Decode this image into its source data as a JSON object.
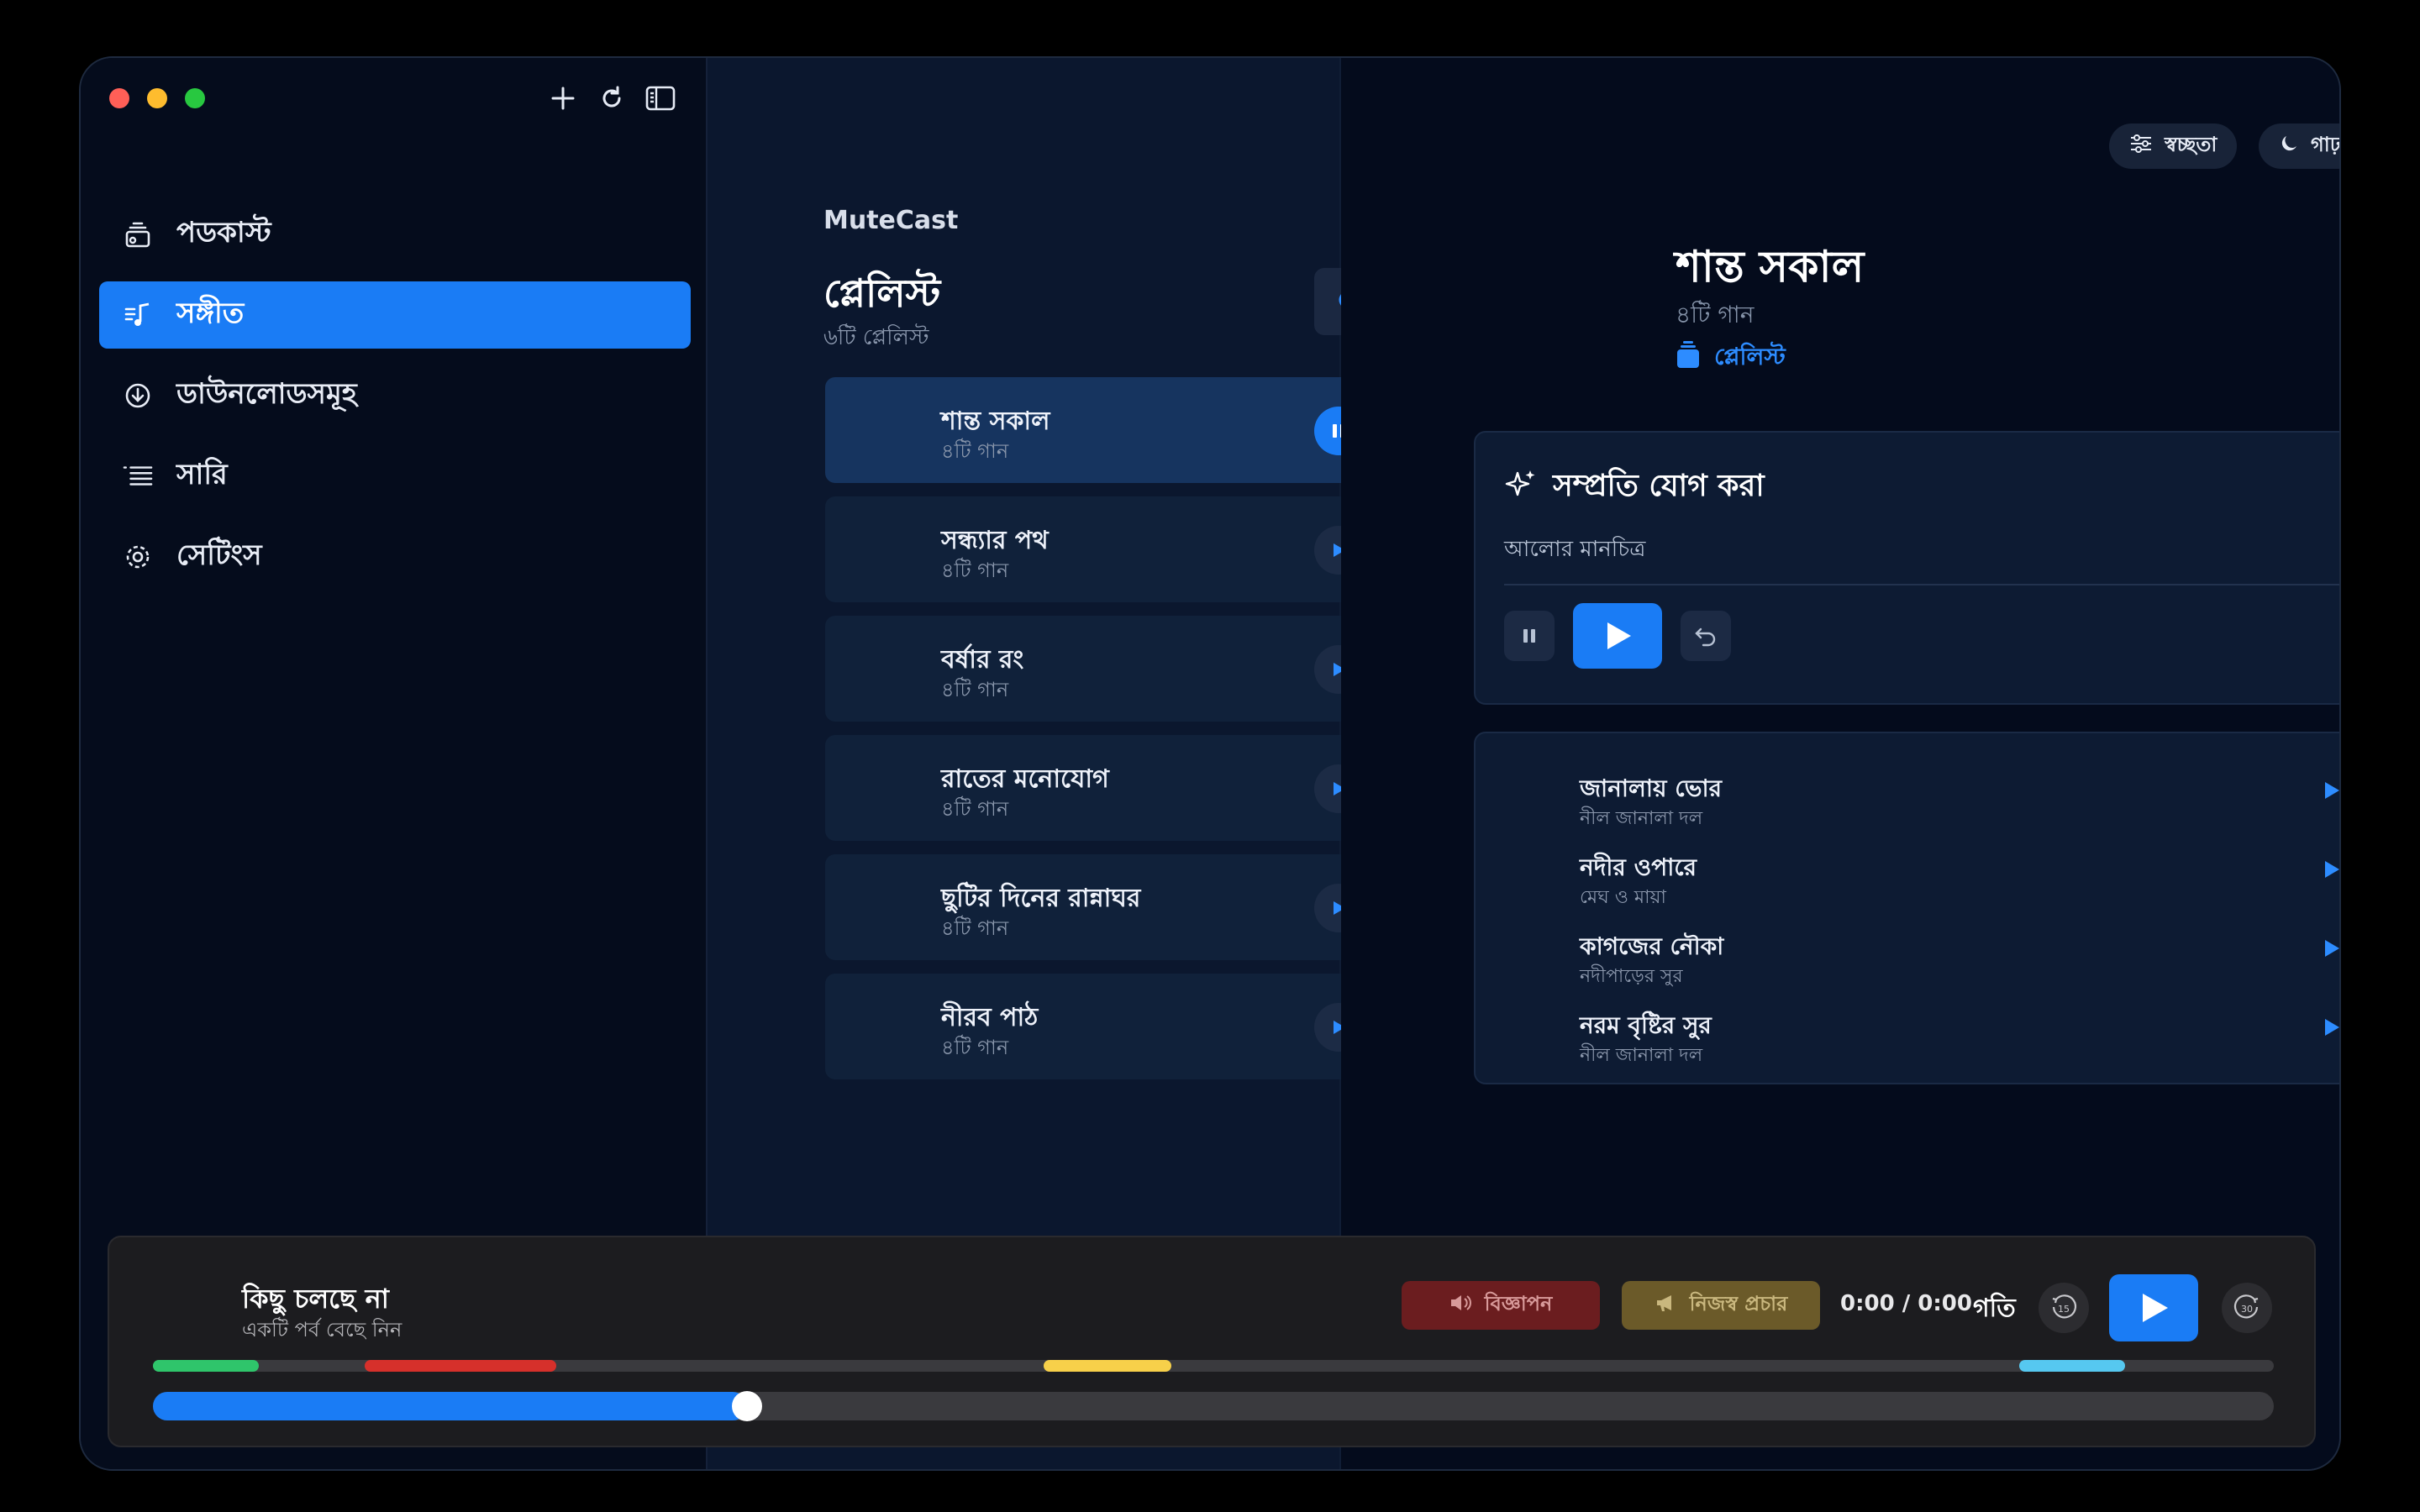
{
  "toolbar": {
    "icons": [
      "plus-icon",
      "refresh-icon",
      "sidebar-toggle-icon"
    ]
  },
  "sidebar": {
    "items": [
      {
        "label": "পডকাস্ট",
        "icon": "podcast-icon"
      },
      {
        "label": "সঙ্গীত",
        "icon": "music-icon",
        "active": true
      },
      {
        "label": "ডাউনলোডসমূহ",
        "icon": "download-icon"
      },
      {
        "label": "সারি",
        "icon": "queue-icon"
      },
      {
        "label": "সেটিংস",
        "icon": "gear-icon"
      }
    ]
  },
  "middle": {
    "brand": "MuteCast",
    "title": "প্লেলিস্ট",
    "subtitle": "৬টি প্লেলিস্ট",
    "playlists": [
      {
        "title": "শান্ত সকাল",
        "subtitle": "৪টি গান",
        "state": "playing"
      },
      {
        "title": "সন্ধ্যার পথ",
        "subtitle": "৪টি গান",
        "state": "paused"
      },
      {
        "title": "বর্ষার রং",
        "subtitle": "৪টি গান",
        "state": "paused"
      },
      {
        "title": "রাতের মনোযোগ",
        "subtitle": "৪টি গান",
        "state": "paused"
      },
      {
        "title": "ছুটির দিনের রান্নাঘর",
        "subtitle": "৪টি গান",
        "state": "paused"
      },
      {
        "title": "নীরব পাঠ",
        "subtitle": "৪টি গান",
        "state": "paused"
      }
    ]
  },
  "right": {
    "controls": {
      "transparency_label": "স্বচ্ছতা",
      "theme_label": "গাঢ়"
    },
    "playlist_title": "শান্ত সকাল",
    "playlist_sub": "৪টি গান",
    "playlist_tag": "প্লেলিস্ট",
    "recent": {
      "title": "সম্প্রতি যোগ করা",
      "item": "আলোর মানচিত্র"
    },
    "songs": [
      {
        "title": "জানালায় ভোর",
        "artist": "নীল জানালা দল"
      },
      {
        "title": "নদীর ওপারে",
        "artist": "মেঘ ও মায়া"
      },
      {
        "title": "কাগজের নৌকা",
        "artist": "নদীপাড়ের সুর"
      },
      {
        "title": "নরম বৃষ্টির সুর",
        "artist": "নীল জানালা দল"
      }
    ]
  },
  "player": {
    "now_playing": "কিছু চলছে না",
    "hint": "একটি পর্ব বেছে নিন",
    "ad_label": "বিজ্ঞাপন",
    "promo_label": "নিজস্ব প্রচার",
    "time": "0:00 / 0:00",
    "speed_label": "গতি",
    "skip_back": "15",
    "skip_forward": "30",
    "progress": 0.28,
    "colors": {
      "accent": "#1a7cf5",
      "ad": "#6b1d1f",
      "promo": "#6b5a29"
    },
    "markers": [
      {
        "start": 0.0,
        "end": 0.05,
        "color": "#2fc56b"
      },
      {
        "start": 0.1,
        "end": 0.19,
        "color": "#d6302b"
      },
      {
        "start": 0.42,
        "end": 0.48,
        "color": "#f7d04a"
      },
      {
        "start": 0.88,
        "end": 0.93,
        "color": "#56c8f0"
      }
    ]
  }
}
